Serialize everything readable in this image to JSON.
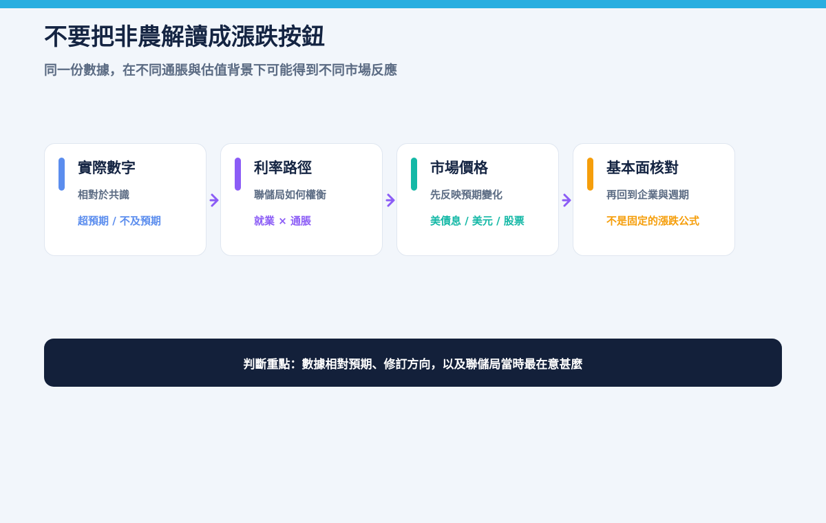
{
  "title": "不要把非農解讀成漲跌按鈕",
  "subtitle": "同一份數據，在不同通脹與估值背景下可能得到不同市場反應",
  "flow": [
    {
      "title": "實際數字",
      "description": "相對於共識",
      "tag": "超預期 / 不及預期",
      "accent_color": "#5b8dee",
      "tag_color": "#5b8dee"
    },
    {
      "title": "利率路徑",
      "description": "聯儲局如何權衡",
      "tag": "就業 × 通脹",
      "accent_color": "#8b5cf6",
      "tag_color": "#8b5cf6"
    },
    {
      "title": "市場價格",
      "description": "先反映預期變化",
      "tag": "美債息 / 美元 / 股票",
      "accent_color": "#14b8a6",
      "tag_color": "#14b8a6"
    },
    {
      "title": "基本面核對",
      "description": "再回到企業與週期",
      "tag": "不是固定的漲跌公式",
      "accent_color": "#f59e0b",
      "tag_color": "#f59e0b"
    }
  ],
  "arrow_color": "#8b5cf6",
  "summary": "判斷重點：數據相對預期、修訂方向，以及聯儲局當時最在意甚麼",
  "colors": {
    "top_bar": "#29aee0",
    "background": "#f2f6fb",
    "banner": "#13203a",
    "title": "#142442",
    "subtitle": "#5b6b83"
  }
}
